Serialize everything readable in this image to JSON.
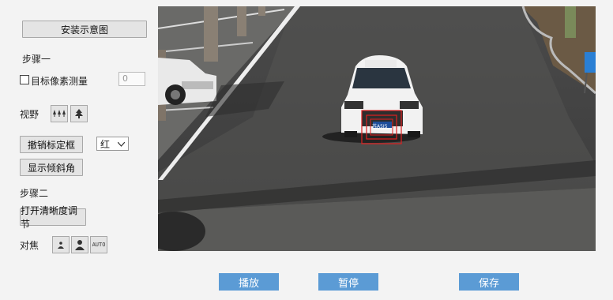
{
  "left_panel": {
    "install_diagram_button": "安装示意图",
    "step1_label": "步骤一",
    "target_pixel_checkbox_label": "目标像素测量",
    "target_pixel_value": "0",
    "view_label": "视野",
    "cancel_frame_button": "撤销标定框",
    "color_select_value": "红",
    "show_tilt_button": "显示倾斜角",
    "step2_label": "步骤二",
    "clarity_button": "打开清晰度调节",
    "focus_label": "对焦",
    "focus_auto_label": "AUTO"
  },
  "video": {
    "plate_text": "苏A5J5"
  },
  "bottom": {
    "play_button": "播放",
    "pause_button": "暂停",
    "save_button": "保存"
  },
  "colors": {
    "accent_blue": "#5b9bd5",
    "calibration_red": "#e02020"
  }
}
